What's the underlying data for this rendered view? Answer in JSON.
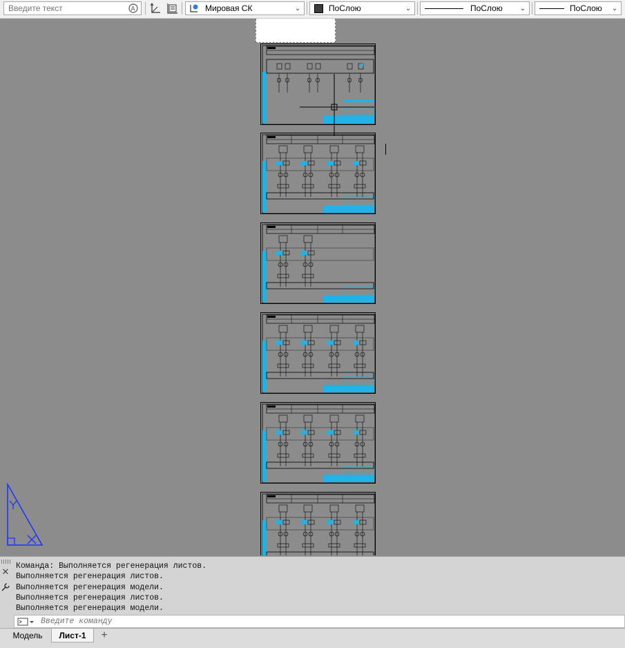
{
  "toolbar": {
    "search_placeholder": "Введите текст",
    "ucs_label": "Мировая СК",
    "color_label": "ПоСлою",
    "linetype_label": "ПоСлою",
    "lineweight_label": "ПоСлою"
  },
  "command": {
    "history": [
      "Команда: Выполняется регенерация листов.",
      "Выполняется регенерация листов.",
      "Выполняется регенерация модели.",
      "Выполняется регенерация листов.",
      "Выполняется регенерация модели."
    ],
    "input_placeholder": "Введите команду"
  },
  "tabs": [
    {
      "label": "Модель",
      "active": false
    },
    {
      "label": "Лист-1",
      "active": true
    }
  ],
  "ucs_icon": {
    "y_label": "Y",
    "x_label": "X"
  },
  "colors": {
    "accent": "#1fb3e8",
    "ucs": "#1a33ff",
    "canvas": "#8c8c8c"
  }
}
